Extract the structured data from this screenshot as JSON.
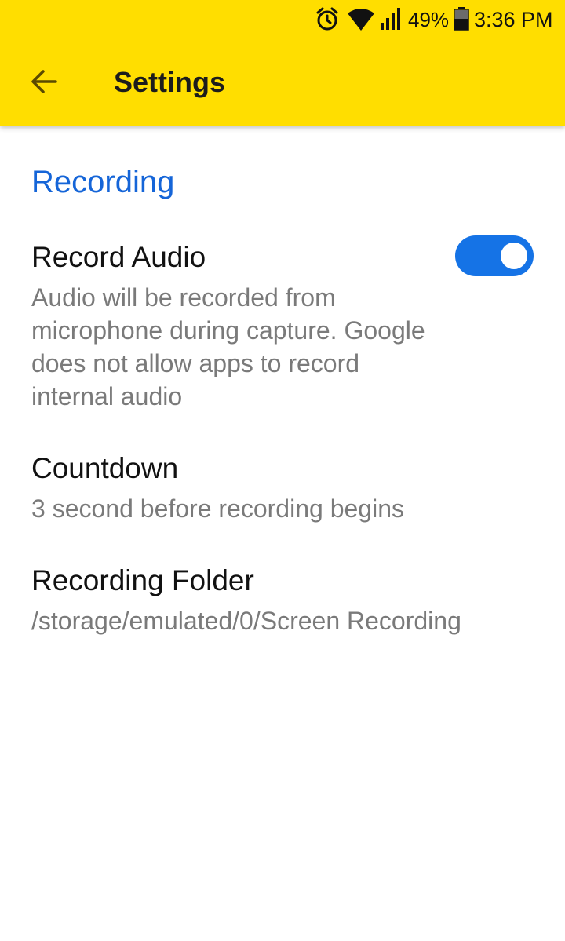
{
  "status_bar": {
    "battery_percent": "49%",
    "time": "3:36 PM",
    "icons": [
      "alarm-icon",
      "wifi-icon",
      "cell-signal-icon",
      "battery-icon"
    ]
  },
  "toolbar": {
    "back_icon": "arrow-back-icon",
    "title": "Settings"
  },
  "settings": {
    "category": "Recording",
    "record_audio": {
      "title": "Record Audio",
      "summary": "Audio will be recorded from microphone during capture. Google does not allow apps to record internal audio",
      "enabled": true
    },
    "countdown": {
      "title": "Countdown",
      "summary": "3 second before recording begins"
    },
    "recording_folder": {
      "title": "Recording Folder",
      "summary": "/storage/emulated/0/Screen Recording"
    }
  },
  "colors": {
    "appbar": "#FFDE00",
    "accent": "#1565D8",
    "switch_on": "#1573E6",
    "summary_text": "#7a7a7a"
  }
}
